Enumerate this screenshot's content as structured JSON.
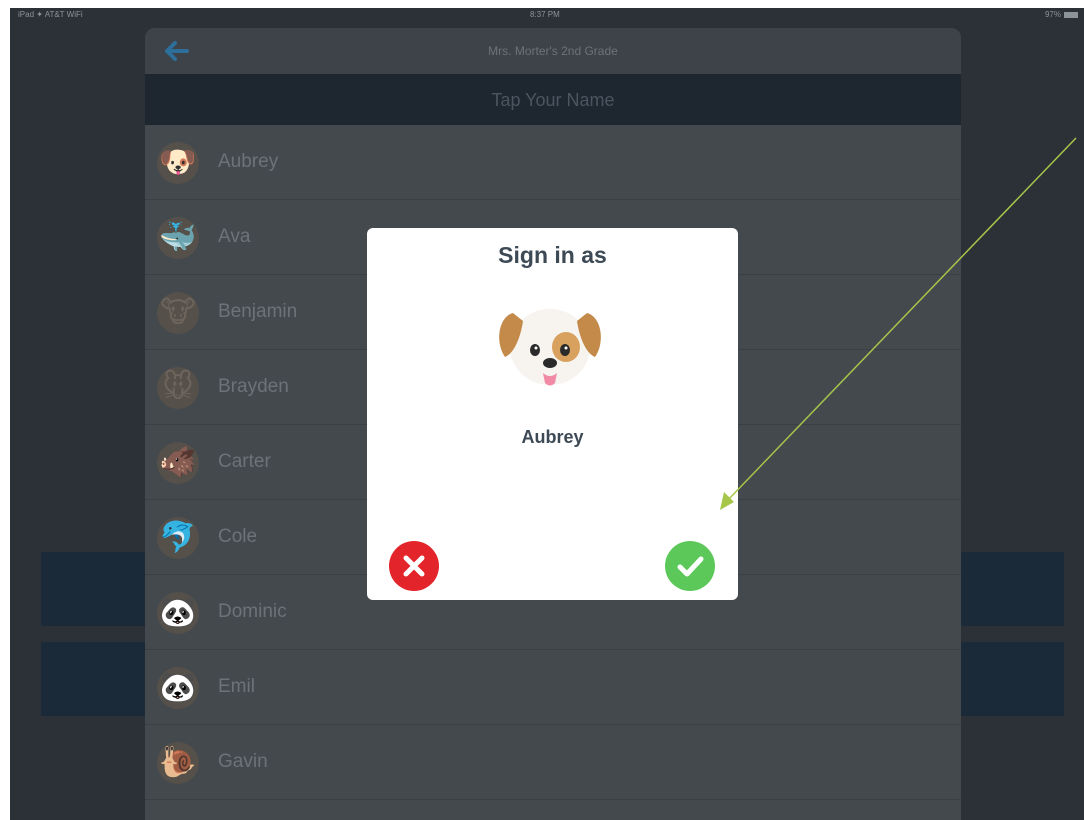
{
  "statusbar": {
    "left": "iPad ✦ AT&T WiFi",
    "time": "8:37 PM",
    "battery": "97%"
  },
  "navbar": {
    "title": "Mrs. Morter's 2nd Grade",
    "back_icon": "back-arrow-icon"
  },
  "subheader": {
    "title": "Tap Your Name"
  },
  "students": [
    {
      "name": "Aubrey",
      "avatar": "🐶"
    },
    {
      "name": "Ava",
      "avatar": "🐳"
    },
    {
      "name": "Benjamin",
      "avatar": "🐮"
    },
    {
      "name": "Brayden",
      "avatar": "🐭"
    },
    {
      "name": "Carter",
      "avatar": "🐗"
    },
    {
      "name": "Cole",
      "avatar": "🐬"
    },
    {
      "name": "Dominic",
      "avatar": "🐼"
    },
    {
      "name": "Emil",
      "avatar": "🐼"
    },
    {
      "name": "Gavin",
      "avatar": "🐌"
    }
  ],
  "modal": {
    "title": "Sign in as",
    "selected_name": "Aubrey",
    "avatar_icon": "dog-face-icon",
    "cancel_icon": "close-icon",
    "confirm_icon": "checkmark-icon"
  },
  "colors": {
    "cancel": "#e3242b",
    "confirm": "#5cc85a",
    "annotation_arrow": "#a6c64a"
  }
}
